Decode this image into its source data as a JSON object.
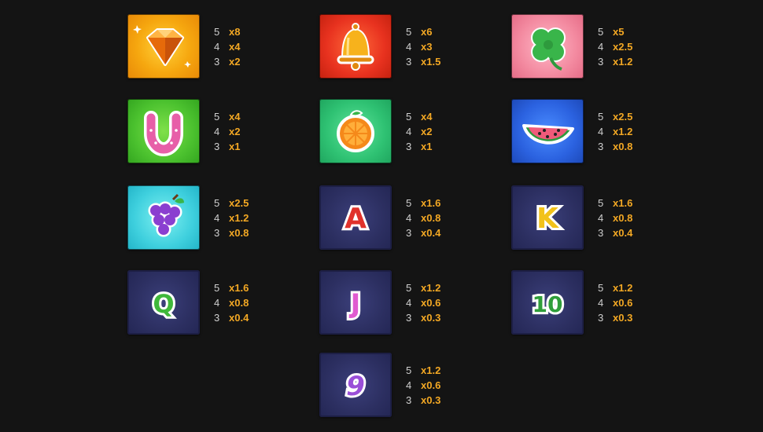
{
  "paytable": {
    "diamond": {
      "icon": "diamond-icon",
      "pays": [
        {
          "count": "5",
          "mult": "x8"
        },
        {
          "count": "4",
          "mult": "x4"
        },
        {
          "count": "3",
          "mult": "x2"
        }
      ]
    },
    "bell": {
      "icon": "bell-icon",
      "pays": [
        {
          "count": "5",
          "mult": "x6"
        },
        {
          "count": "4",
          "mult": "x3"
        },
        {
          "count": "3",
          "mult": "x1.5"
        }
      ]
    },
    "clover": {
      "icon": "clover-icon",
      "pays": [
        {
          "count": "5",
          "mult": "x5"
        },
        {
          "count": "4",
          "mult": "x2.5"
        },
        {
          "count": "3",
          "mult": "x1.2"
        }
      ]
    },
    "horseshoe": {
      "icon": "horseshoe-icon",
      "pays": [
        {
          "count": "5",
          "mult": "x4"
        },
        {
          "count": "4",
          "mult": "x2"
        },
        {
          "count": "3",
          "mult": "x1"
        }
      ]
    },
    "orange": {
      "icon": "orange-icon",
      "pays": [
        {
          "count": "5",
          "mult": "x4"
        },
        {
          "count": "4",
          "mult": "x2"
        },
        {
          "count": "3",
          "mult": "x1"
        }
      ]
    },
    "watermelon": {
      "icon": "watermelon-icon",
      "pays": [
        {
          "count": "5",
          "mult": "x2.5"
        },
        {
          "count": "4",
          "mult": "x1.2"
        },
        {
          "count": "3",
          "mult": "x0.8"
        }
      ]
    },
    "grapes": {
      "icon": "grapes-icon",
      "pays": [
        {
          "count": "5",
          "mult": "x2.5"
        },
        {
          "count": "4",
          "mult": "x1.2"
        },
        {
          "count": "3",
          "mult": "x0.8"
        }
      ]
    },
    "ace": {
      "letter": "A",
      "color": "#e0322b",
      "pays": [
        {
          "count": "5",
          "mult": "x1.6"
        },
        {
          "count": "4",
          "mult": "x0.8"
        },
        {
          "count": "3",
          "mult": "x0.4"
        }
      ]
    },
    "king": {
      "letter": "K",
      "color": "#f2c21a",
      "pays": [
        {
          "count": "5",
          "mult": "x1.6"
        },
        {
          "count": "4",
          "mult": "x0.8"
        },
        {
          "count": "3",
          "mult": "x0.4"
        }
      ]
    },
    "queen": {
      "letter": "Q",
      "color": "#3fb83a",
      "pays": [
        {
          "count": "5",
          "mult": "x1.6"
        },
        {
          "count": "4",
          "mult": "x0.8"
        },
        {
          "count": "3",
          "mult": "x0.4"
        }
      ]
    },
    "jack": {
      "letter": "J",
      "color": "#e05ad0",
      "pays": [
        {
          "count": "5",
          "mult": "x1.2"
        },
        {
          "count": "4",
          "mult": "x0.6"
        },
        {
          "count": "3",
          "mult": "x0.3"
        }
      ]
    },
    "ten": {
      "letter": "10",
      "color": "#2f9e3a",
      "pays": [
        {
          "count": "5",
          "mult": "x1.2"
        },
        {
          "count": "4",
          "mult": "x0.6"
        },
        {
          "count": "3",
          "mult": "x0.3"
        }
      ]
    },
    "nine": {
      "letter": "9",
      "color": "#9a4fd8",
      "pays": [
        {
          "count": "5",
          "mult": "x1.2"
        },
        {
          "count": "4",
          "mult": "x0.6"
        },
        {
          "count": "3",
          "mult": "x0.3"
        }
      ]
    }
  },
  "colors": {
    "count_text": "#cfcfcf",
    "multiplier_text": "#f3a824",
    "background": "#141414"
  }
}
